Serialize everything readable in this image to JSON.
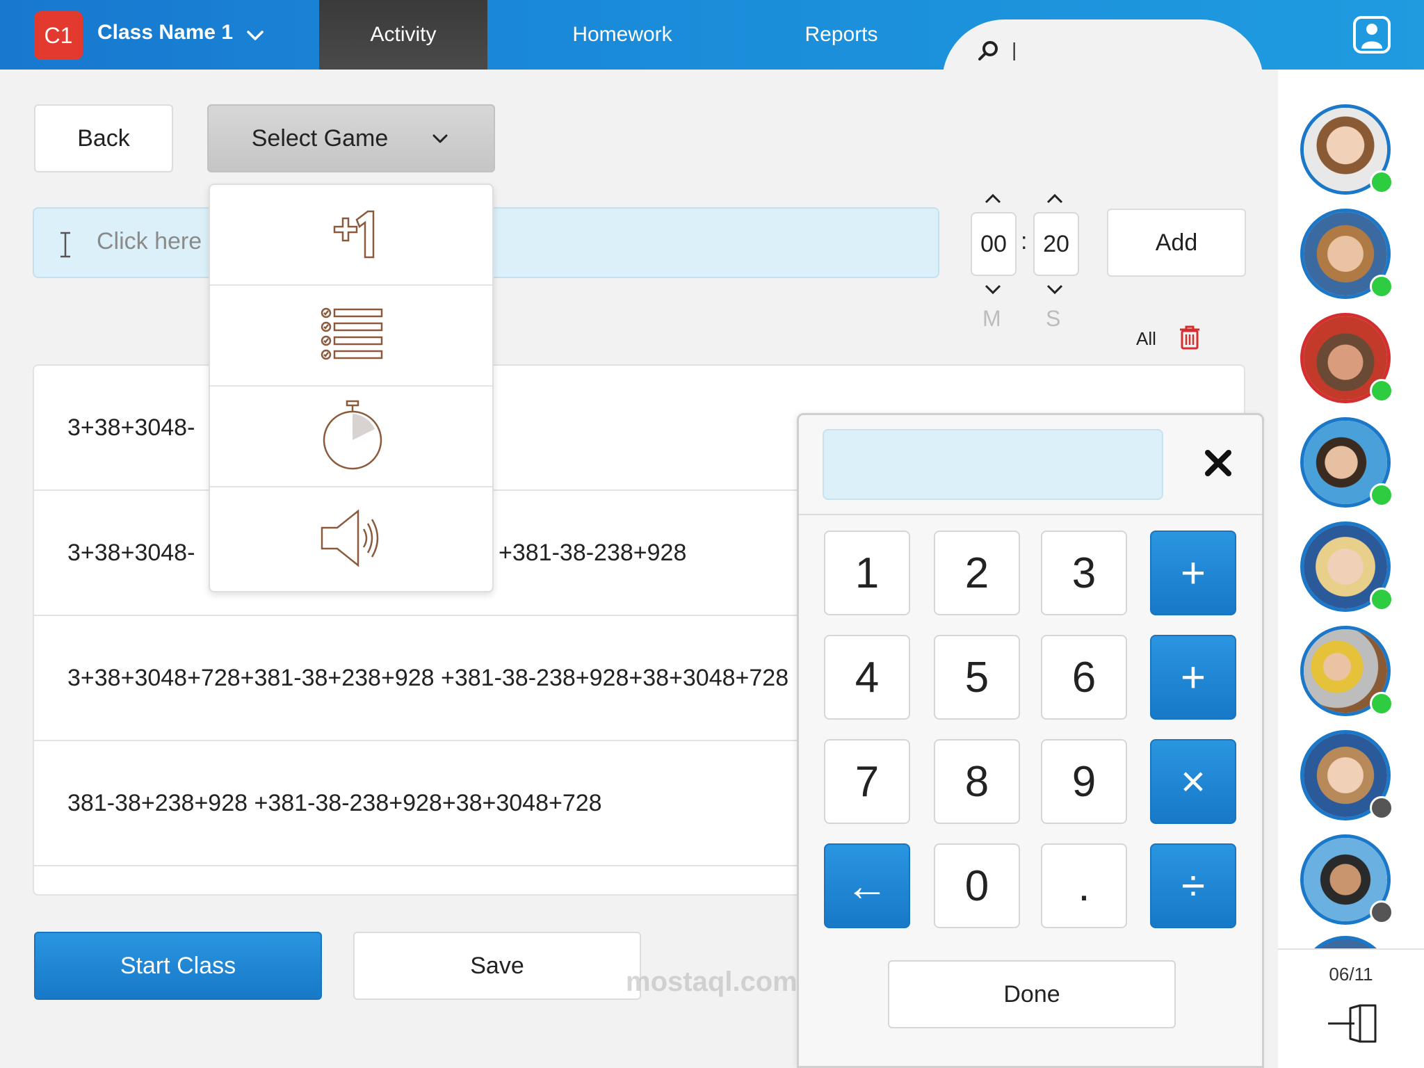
{
  "header": {
    "class_badge": "C1",
    "class_name": "Class Name 1",
    "tabs": [
      {
        "label": "Activity",
        "active": true
      },
      {
        "label": "Homework",
        "active": false
      },
      {
        "label": "Reports",
        "active": false
      }
    ],
    "search": {
      "value": "|",
      "placeholder": ""
    }
  },
  "toolbar": {
    "back_label": "Back",
    "select_game_label": "Select Game"
  },
  "question_input": {
    "placeholder": "Click here"
  },
  "timer": {
    "minutes": "00",
    "seconds": "20",
    "separator": ":",
    "minutes_label": "M",
    "seconds_label": "S"
  },
  "add_label": "Add",
  "delete_all_label": "All",
  "game_options": [
    {
      "icon": "plus-one-icon"
    },
    {
      "icon": "checklist-icon"
    },
    {
      "icon": "stopwatch-icon"
    },
    {
      "icon": "speaker-icon"
    }
  ],
  "questions": [
    {
      "text": "3+38+3048-"
    },
    {
      "text": "3+38+3048-",
      "tail": "+381-38-238+928"
    },
    {
      "text": "3+38+3048+728+381-38+238+928 +381-38-238+928+38+3048+728"
    },
    {
      "text": "381-38+238+928 +381-38-238+928+38+3048+728"
    }
  ],
  "actions": {
    "start_label": "Start Class",
    "save_label": "Save"
  },
  "keypad": {
    "display_value": "",
    "keys": [
      {
        "label": "1",
        "type": "digit"
      },
      {
        "label": "2",
        "type": "digit"
      },
      {
        "label": "3",
        "type": "digit"
      },
      {
        "label": "+",
        "type": "op"
      },
      {
        "label": "4",
        "type": "digit"
      },
      {
        "label": "5",
        "type": "digit"
      },
      {
        "label": "6",
        "type": "digit"
      },
      {
        "label": "+",
        "type": "op"
      },
      {
        "label": "7",
        "type": "digit"
      },
      {
        "label": "8",
        "type": "digit"
      },
      {
        "label": "9",
        "type": "digit"
      },
      {
        "label": "×",
        "type": "op"
      },
      {
        "label": "←",
        "type": "op"
      },
      {
        "label": "0",
        "type": "digit"
      },
      {
        "label": ".",
        "type": "digit"
      },
      {
        "label": "÷",
        "type": "op"
      }
    ],
    "done_label": "Done"
  },
  "students": [
    {
      "status": "online",
      "status_color": "#2ecc40",
      "border": "#1b78c9"
    },
    {
      "status": "online",
      "status_color": "#2ecc40",
      "border": "#1b78c9"
    },
    {
      "status": "online",
      "status_color": "#2ecc40",
      "border": "#d52e2e"
    },
    {
      "status": "online",
      "status_color": "#2ecc40",
      "border": "#1b78c9"
    },
    {
      "status": "online",
      "status_color": "#2ecc40",
      "border": "#1b78c9"
    },
    {
      "status": "online",
      "status_color": "#2ecc40",
      "border": "#1b78c9"
    },
    {
      "status": "offline",
      "status_color": "#555555",
      "border": "#1b78c9"
    },
    {
      "status": "offline",
      "status_color": "#555555",
      "border": "#1b78c9"
    }
  ],
  "student_count": "06/11",
  "watermark": "mostaql.com",
  "colors": {
    "accent": "#1a84d4",
    "danger": "#d52e2e",
    "online": "#2ecc40"
  }
}
